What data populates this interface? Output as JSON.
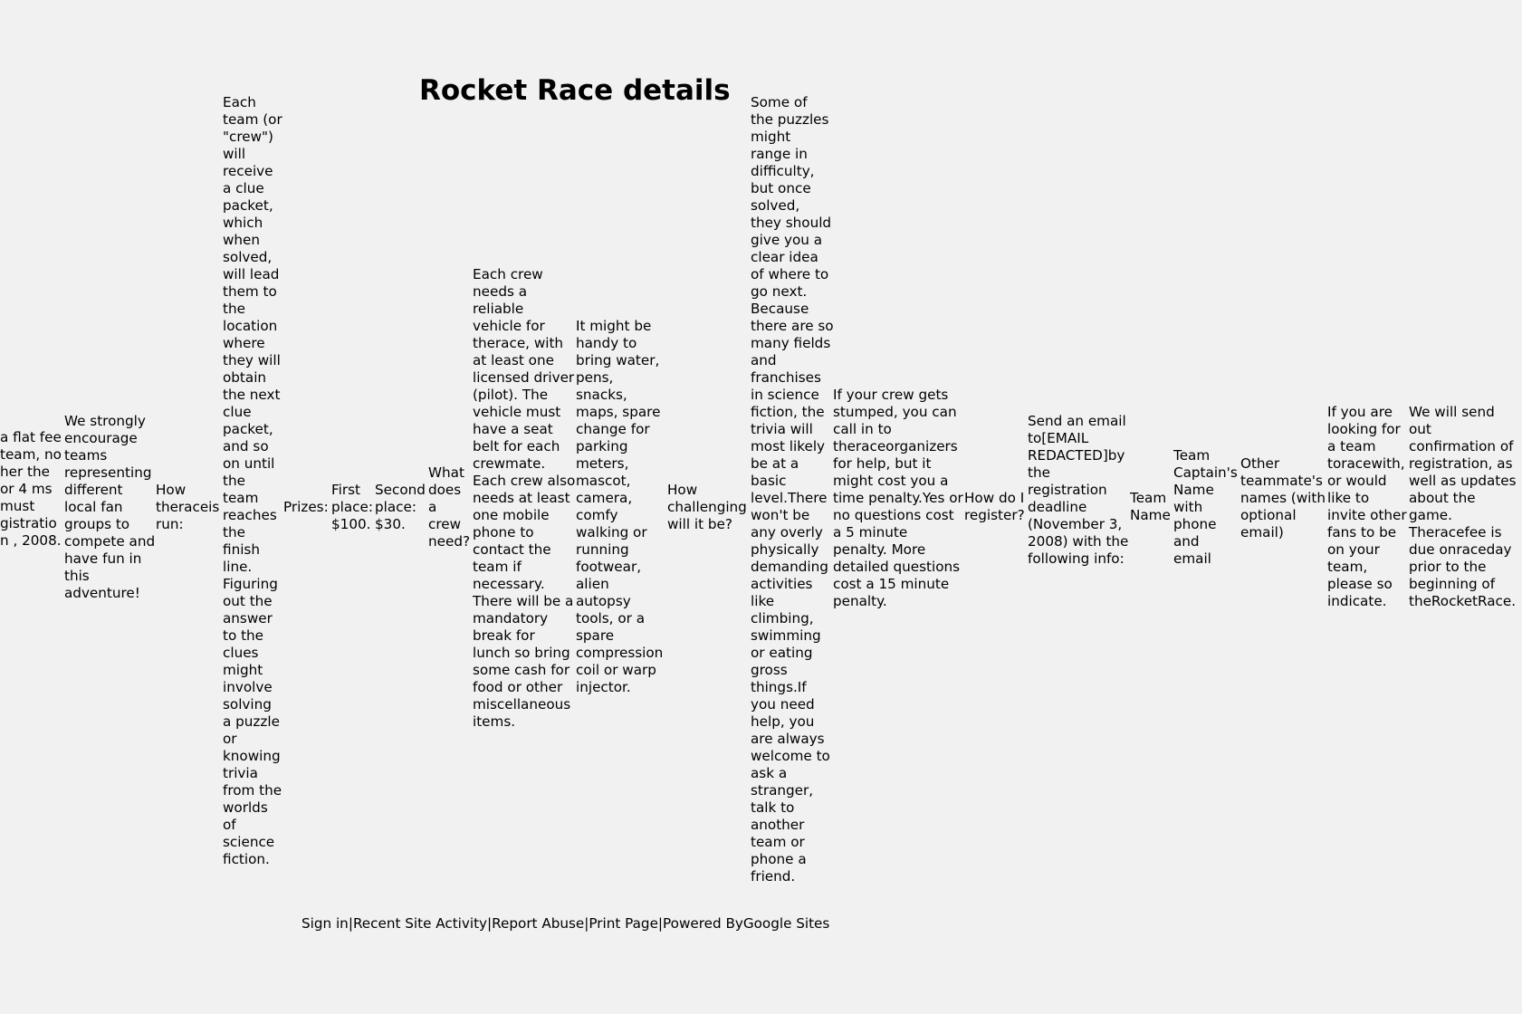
{
  "page": {
    "title": "Rocket Race details"
  },
  "columns": [
    {
      "id": "fee-partial",
      "text": "a flat fee team, no her the or 4 ms must gistration , 2008."
    },
    {
      "id": "encourage",
      "text": "We strongly encourage teams representing different local fan groups to compete and have fun in this adventure!"
    },
    {
      "id": "how-race-run",
      "text": "How theraceis run:"
    },
    {
      "id": "clue-packet",
      "text": "Each team (or \"crew\") will receive a clue packet, which when solved, will lead them to the location where they will obtain the next clue packet, and so on until the team reaches the finish line. Figuring out the answer to the clues might involve solving a puzzle or knowing trivia from the worlds of science fiction."
    },
    {
      "id": "prizes-label",
      "text": "Prizes:"
    },
    {
      "id": "first-place",
      "text": "First place: $100."
    },
    {
      "id": "second-place",
      "text": "Second place: $30."
    },
    {
      "id": "what-need",
      "text": "What does a crew need?"
    },
    {
      "id": "vehicle",
      "text": "Each crew needs a reliable vehicle for therace, with at least one licensed driver (pilot). The vehicle must have a seat belt for each crewmate. Each crew also needs at least one mobile phone to contact the team if necessary. There will be a mandatory break for lunch so bring some cash for food or other miscellaneous items."
    },
    {
      "id": "handy",
      "text": "It might be handy to bring water, pens, snacks, maps, spare change for parking meters, mascot, camera, comfy walking or running footwear, alien autopsy tools, or a spare compression coil or warp injector."
    },
    {
      "id": "how-challenging",
      "text": "How challenging will it be?"
    },
    {
      "id": "puzzles",
      "text": "Some of the puzzles might range in difficulty, but once solved, they should give you a clear idea of where to go next. Because there are so many fields and franchises in science fiction, the trivia will most likely be at a basic level.There won't be any overly physically demanding activities like climbing, swimming or eating gross things.If you need help, you are always welcome to ask a stranger, talk to another team or phone a friend."
    },
    {
      "id": "stumped",
      "text": "If your crew gets stumped, you can call in to theraceorganizers for help, but it might cost you a time penalty.Yes or no questions cost a 5 minute penalty. More detailed questions cost a 15 minute penalty."
    },
    {
      "id": "how-register",
      "text": "How do I register?"
    },
    {
      "id": "send-email",
      "text": "Send an email to[EMAIL REDACTED]by the registration deadline (November 3, 2008) with the following info:"
    },
    {
      "id": "team-name",
      "text": "Team Name"
    },
    {
      "id": "team-captain",
      "text": "Team Captain's Name with phone and email"
    },
    {
      "id": "other-teammates",
      "text": "Other teammate's names (with optional email)"
    },
    {
      "id": "looking-for-team",
      "text": "If you are looking for a team toracewith, or would like to invite other fans to be on your team, please so indicate."
    },
    {
      "id": "confirmation",
      "text": "We will send out confirmation of registration, as well as updates about the game. Theracefee is due onraceday prior to the beginning of theRocketRace."
    }
  ],
  "footer": {
    "sign_in": "Sign in",
    "sep1": "|",
    "recent_activity": "Recent Site Activity",
    "sep2": "|",
    "report_abuse": "Report Abuse",
    "sep3": "|",
    "print_page": "Print Page",
    "sep4": "|",
    "powered_by": "Powered By",
    "google_sites": "Google Sites"
  }
}
